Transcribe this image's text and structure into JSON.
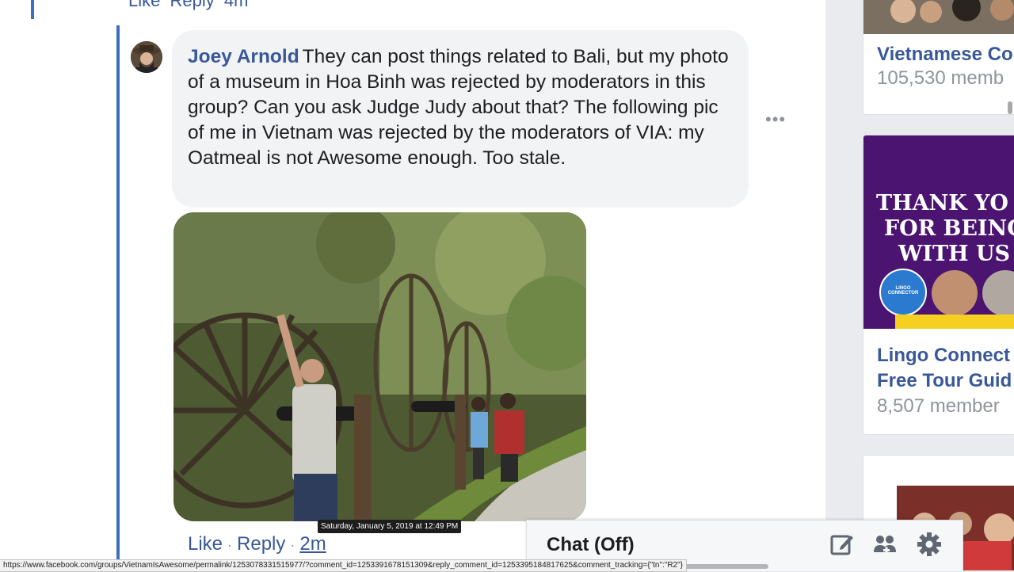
{
  "previous_comment": {
    "like": "Like",
    "reply": "Reply",
    "time": "4m"
  },
  "comment": {
    "author": "Joey Arnold",
    "text": "They can post things related to Bali, but my photo of a museum in Hoa Binh was rejected by moderators in this group? Can you ask Judge Judy about that? The following pic of me in Vietnam was rejected by the moderators of VIA: my Oatmeal is not Awesome enough. Too stale.",
    "more_icon": "ellipsis-icon",
    "photo_tooltip": "Saturday, January 5, 2019 at 12:49 PM",
    "like_label": "Like",
    "reply_label": "Reply",
    "separator": "·",
    "time": "2m"
  },
  "status_url": "https://www.facebook.com/groups/VietnamIsAwesome/permalink/1253078331515977/?comment_id=1253391678151309&reply_comment_id=1253395184817625&comment_tracking={\"tn\":\"R2\"}",
  "sidebar": {
    "cards": [
      {
        "title": "Vietnamese Co",
        "members": "105,530 memb"
      },
      {
        "title_line1": "Lingo Connect",
        "title_line2": "Free Tour Guid",
        "members": "8,507 member",
        "banner_line1": "THANK YO",
        "banner_line2": "FOR BEING",
        "banner_line3": "WITH US",
        "badge": "LINGO CONNECTOR"
      }
    ]
  },
  "chat": {
    "label": "Chat (Off)",
    "icons": [
      "compose-icon",
      "create-group-icon",
      "settings-gear-icon"
    ]
  },
  "colors": {
    "link": "#385898",
    "thread_line": "#3a6fc4",
    "bubble": "#f2f3f5",
    "banner": "#4a1470"
  }
}
